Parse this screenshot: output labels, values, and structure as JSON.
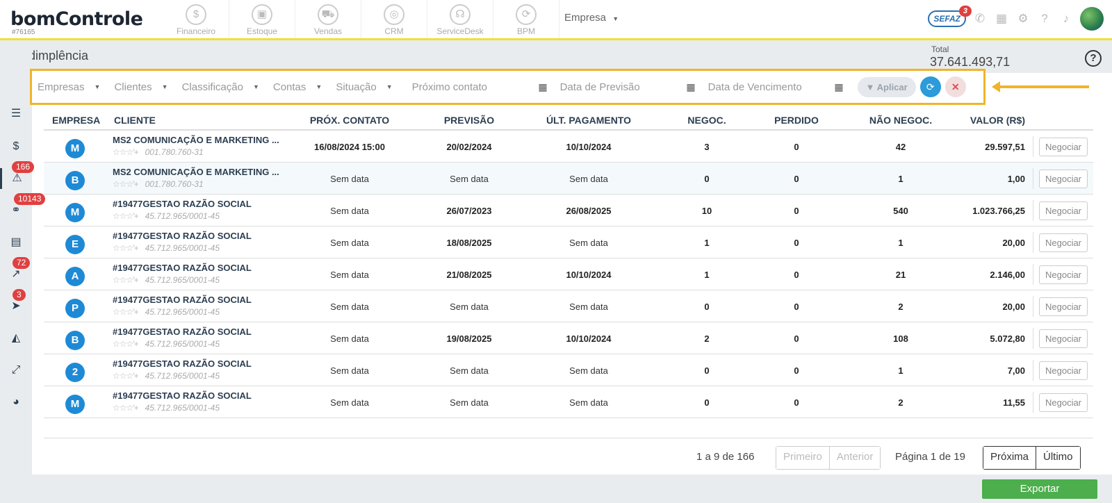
{
  "app": {
    "logo": "bomControle",
    "account_id": "#76165"
  },
  "modules": [
    {
      "label": "Financeiro",
      "icon": "dollar-coin-icon",
      "glyph": "$"
    },
    {
      "label": "Estoque",
      "icon": "box-icon",
      "glyph": "▣"
    },
    {
      "label": "Vendas",
      "icon": "cart-icon",
      "glyph": "⛟"
    },
    {
      "label": "CRM",
      "icon": "target-icon",
      "glyph": "◎"
    },
    {
      "label": "ServiceDesk",
      "icon": "headset-icon",
      "glyph": "☊"
    },
    {
      "label": "BPM",
      "icon": "flow-icon",
      "glyph": "⟳"
    }
  ],
  "empresa_selector": "Empresa",
  "sefaz": {
    "label": "SEFAZ",
    "badge": "3"
  },
  "left_nav_badges": {
    "inadimplencia": "166",
    "links": "10143",
    "chart": "72",
    "send": "3"
  },
  "page": {
    "title": "Inadimplência",
    "total_label": "Total",
    "total_value": "37.641.493,71"
  },
  "filters": {
    "empresas": "Empresas",
    "clientes": "Clientes",
    "classificacao": "Classificação",
    "contas": "Contas",
    "situacao": "Situação",
    "proximo_contato": "Próximo contato",
    "data_previsao": "Data de Previsão",
    "data_vencimento": "Data de Vencimento",
    "aplicar": "Aplicar"
  },
  "table": {
    "headers": {
      "empresa": "EMPRESA",
      "cliente": "CLIENTE",
      "prox_contato": "PRÓX. CONTATO",
      "previsao": "PREVISÃO",
      "ult_pagamento": "ÚLT. PAGAMENTO",
      "negoc": "NEGOC.",
      "perdido": "PERDIDO",
      "nao_negoc": "NÃO NEGOC.",
      "valor": "VALOR (R$)"
    },
    "negociar_label": "Negociar",
    "stars": "☆☆☆'+",
    "rows": [
      {
        "initial": "M",
        "client": "MS2 COMUNICAÇÃO E MARKETING ...",
        "doc": "001.780.760-31",
        "prox": "16/08/2024 15:00",
        "previsao": "20/02/2024",
        "ult": "10/10/2024",
        "negoc": "3",
        "perdido": "0",
        "nao_negoc": "42",
        "valor": "29.597,51"
      },
      {
        "initial": "B",
        "client": "MS2 COMUNICAÇÃO E MARKETING ...",
        "doc": "001.780.760-31",
        "prox": "Sem data",
        "previsao": "Sem data",
        "ult": "Sem data",
        "negoc": "0",
        "perdido": "0",
        "nao_negoc": "1",
        "valor": "1,00"
      },
      {
        "initial": "M",
        "client": "#19477GESTAO RAZÃO SOCIAL",
        "doc": "45.712.965/0001-45",
        "prox": "Sem data",
        "previsao": "26/07/2023",
        "ult": "26/08/2025",
        "negoc": "10",
        "perdido": "0",
        "nao_negoc": "540",
        "valor": "1.023.766,25"
      },
      {
        "initial": "E",
        "client": "#19477GESTAO RAZÃO SOCIAL",
        "doc": "45.712.965/0001-45",
        "prox": "Sem data",
        "previsao": "18/08/2025",
        "ult": "Sem data",
        "negoc": "1",
        "perdido": "0",
        "nao_negoc": "1",
        "valor": "20,00"
      },
      {
        "initial": "A",
        "client": "#19477GESTAO RAZÃO SOCIAL",
        "doc": "45.712.965/0001-45",
        "prox": "Sem data",
        "previsao": "21/08/2025",
        "ult": "10/10/2024",
        "negoc": "1",
        "perdido": "0",
        "nao_negoc": "21",
        "valor": "2.146,00"
      },
      {
        "initial": "P",
        "client": "#19477GESTAO RAZÃO SOCIAL",
        "doc": "45.712.965/0001-45",
        "prox": "Sem data",
        "previsao": "Sem data",
        "ult": "Sem data",
        "negoc": "0",
        "perdido": "0",
        "nao_negoc": "2",
        "valor": "20,00"
      },
      {
        "initial": "B",
        "client": "#19477GESTAO RAZÃO SOCIAL",
        "doc": "45.712.965/0001-45",
        "prox": "Sem data",
        "previsao": "19/08/2025",
        "ult": "10/10/2024",
        "negoc": "2",
        "perdido": "0",
        "nao_negoc": "108",
        "valor": "5.072,80"
      },
      {
        "initial": "2",
        "client": "#19477GESTAO RAZÃO SOCIAL",
        "doc": "45.712.965/0001-45",
        "prox": "Sem data",
        "previsao": "Sem data",
        "ult": "Sem data",
        "negoc": "0",
        "perdido": "0",
        "nao_negoc": "1",
        "valor": "7,00"
      },
      {
        "initial": "M",
        "client": "#19477GESTAO RAZÃO SOCIAL",
        "doc": "45.712.965/0001-45",
        "prox": "Sem data",
        "previsao": "Sem data",
        "ult": "Sem data",
        "negoc": "0",
        "perdido": "0",
        "nao_negoc": "2",
        "valor": "11,55"
      }
    ]
  },
  "pagination": {
    "range": "1 a 9 de 166",
    "primeiro": "Primeiro",
    "anterior": "Anterior",
    "pagina": "Página 1 de 19",
    "proxima": "Próxima",
    "ultimo": "Último"
  },
  "export_label": "Exportar",
  "colors": {
    "accent": "#f0e130",
    "highlight": "#f0b429",
    "primary": "#1e8ad6",
    "success": "#4cae4c",
    "badge": "#e04040"
  }
}
